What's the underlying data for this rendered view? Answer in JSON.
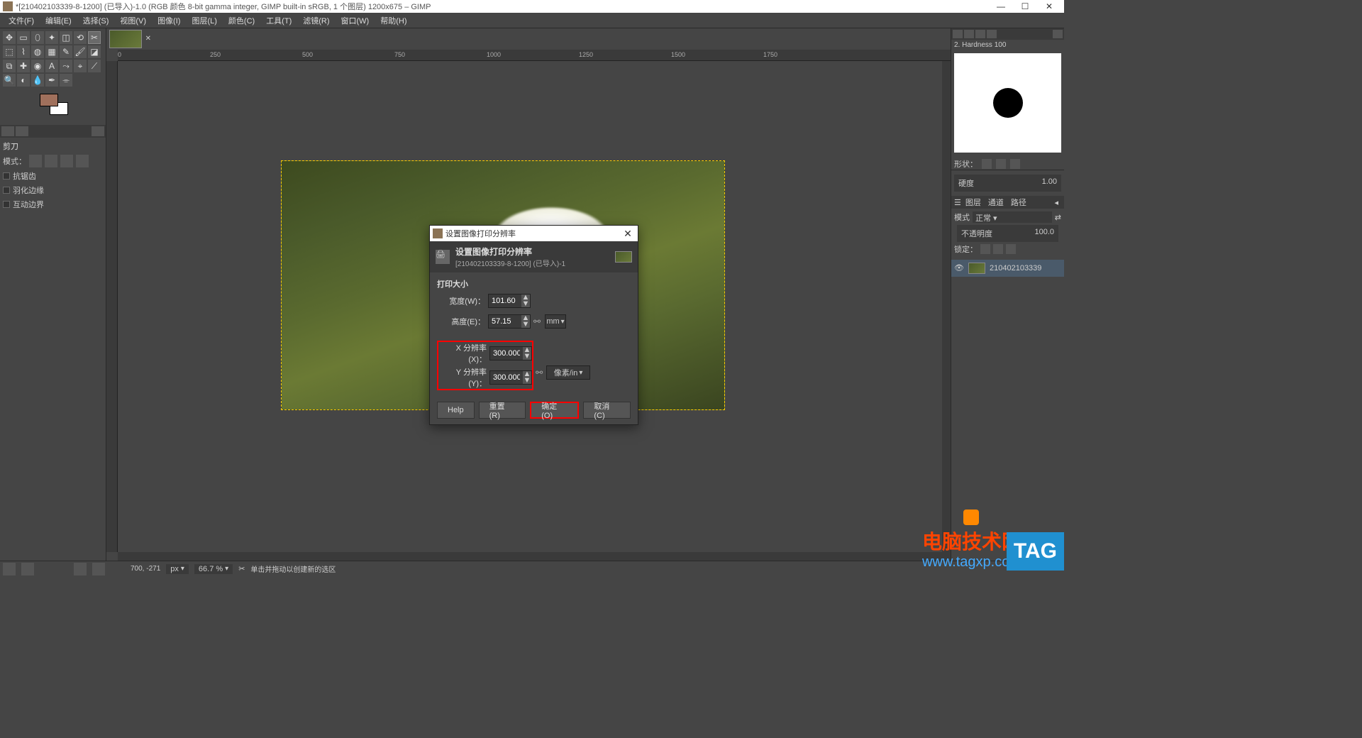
{
  "titlebar": {
    "text": "*[210402103339-8-1200] (已导入)-1.0 (RGB 颜色 8-bit gamma integer, GIMP built-in sRGB, 1 个图层) 1200x675 – GIMP"
  },
  "menu": {
    "file": "文件(F)",
    "edit": "编辑(E)",
    "select": "选择(S)",
    "view": "视图(V)",
    "image": "图像(I)",
    "layer": "图层(L)",
    "colors": "颜色(C)",
    "tools": "工具(T)",
    "filters": "滤镜(R)",
    "windows": "窗口(W)",
    "help": "帮助(H)"
  },
  "toolopts": {
    "title": "剪刀",
    "mode": "模式：",
    "antialias": "抗锯齿",
    "feather": "羽化边缘",
    "interactive": "互动边界"
  },
  "ruler_ticks": [
    "0",
    "250",
    "500",
    "750",
    "1000",
    "1250",
    "1500",
    "1750"
  ],
  "brush": {
    "label": "2. Hardness 100"
  },
  "right": {
    "shape": "形状：",
    "hardness": "硬度",
    "hardness_val": "1.00"
  },
  "layers": {
    "tab_layer": "图层",
    "tab_channel": "通道",
    "tab_path": "路径",
    "mode": "模式",
    "mode_val": "正常",
    "opacity": "不透明度",
    "opacity_val": "100.0",
    "lock": "锁定：",
    "name": "210402103339"
  },
  "dialog": {
    "wintitle": "设置图像打印分辨率",
    "title": "设置图像打印分辨率",
    "subtitle": "[210402103339-8-1200] (已导入)-1",
    "section": "打印大小",
    "width_lbl": "宽度(W)：",
    "width_val": "101.60",
    "height_lbl": "高度(E)：",
    "height_val": "57.15",
    "size_unit": "mm",
    "xres_lbl": "X 分辨率(X)：",
    "xres_val": "300.000",
    "yres_lbl": "Y 分辨率(Y)：",
    "yres_val": "300.000",
    "res_unit": "像素/in",
    "help": "Help",
    "reset": "重置(R)",
    "ok": "确定(O)",
    "cancel": "取消(C)"
  },
  "status": {
    "coords": "700, -271",
    "unit": "px",
    "zoom": "66.7 %",
    "hint": "单击并拖动以创建新的选区"
  },
  "watermark": {
    "text1": "电脑技术网",
    "text2": "www.tagxp.com",
    "tag": "TAG"
  }
}
